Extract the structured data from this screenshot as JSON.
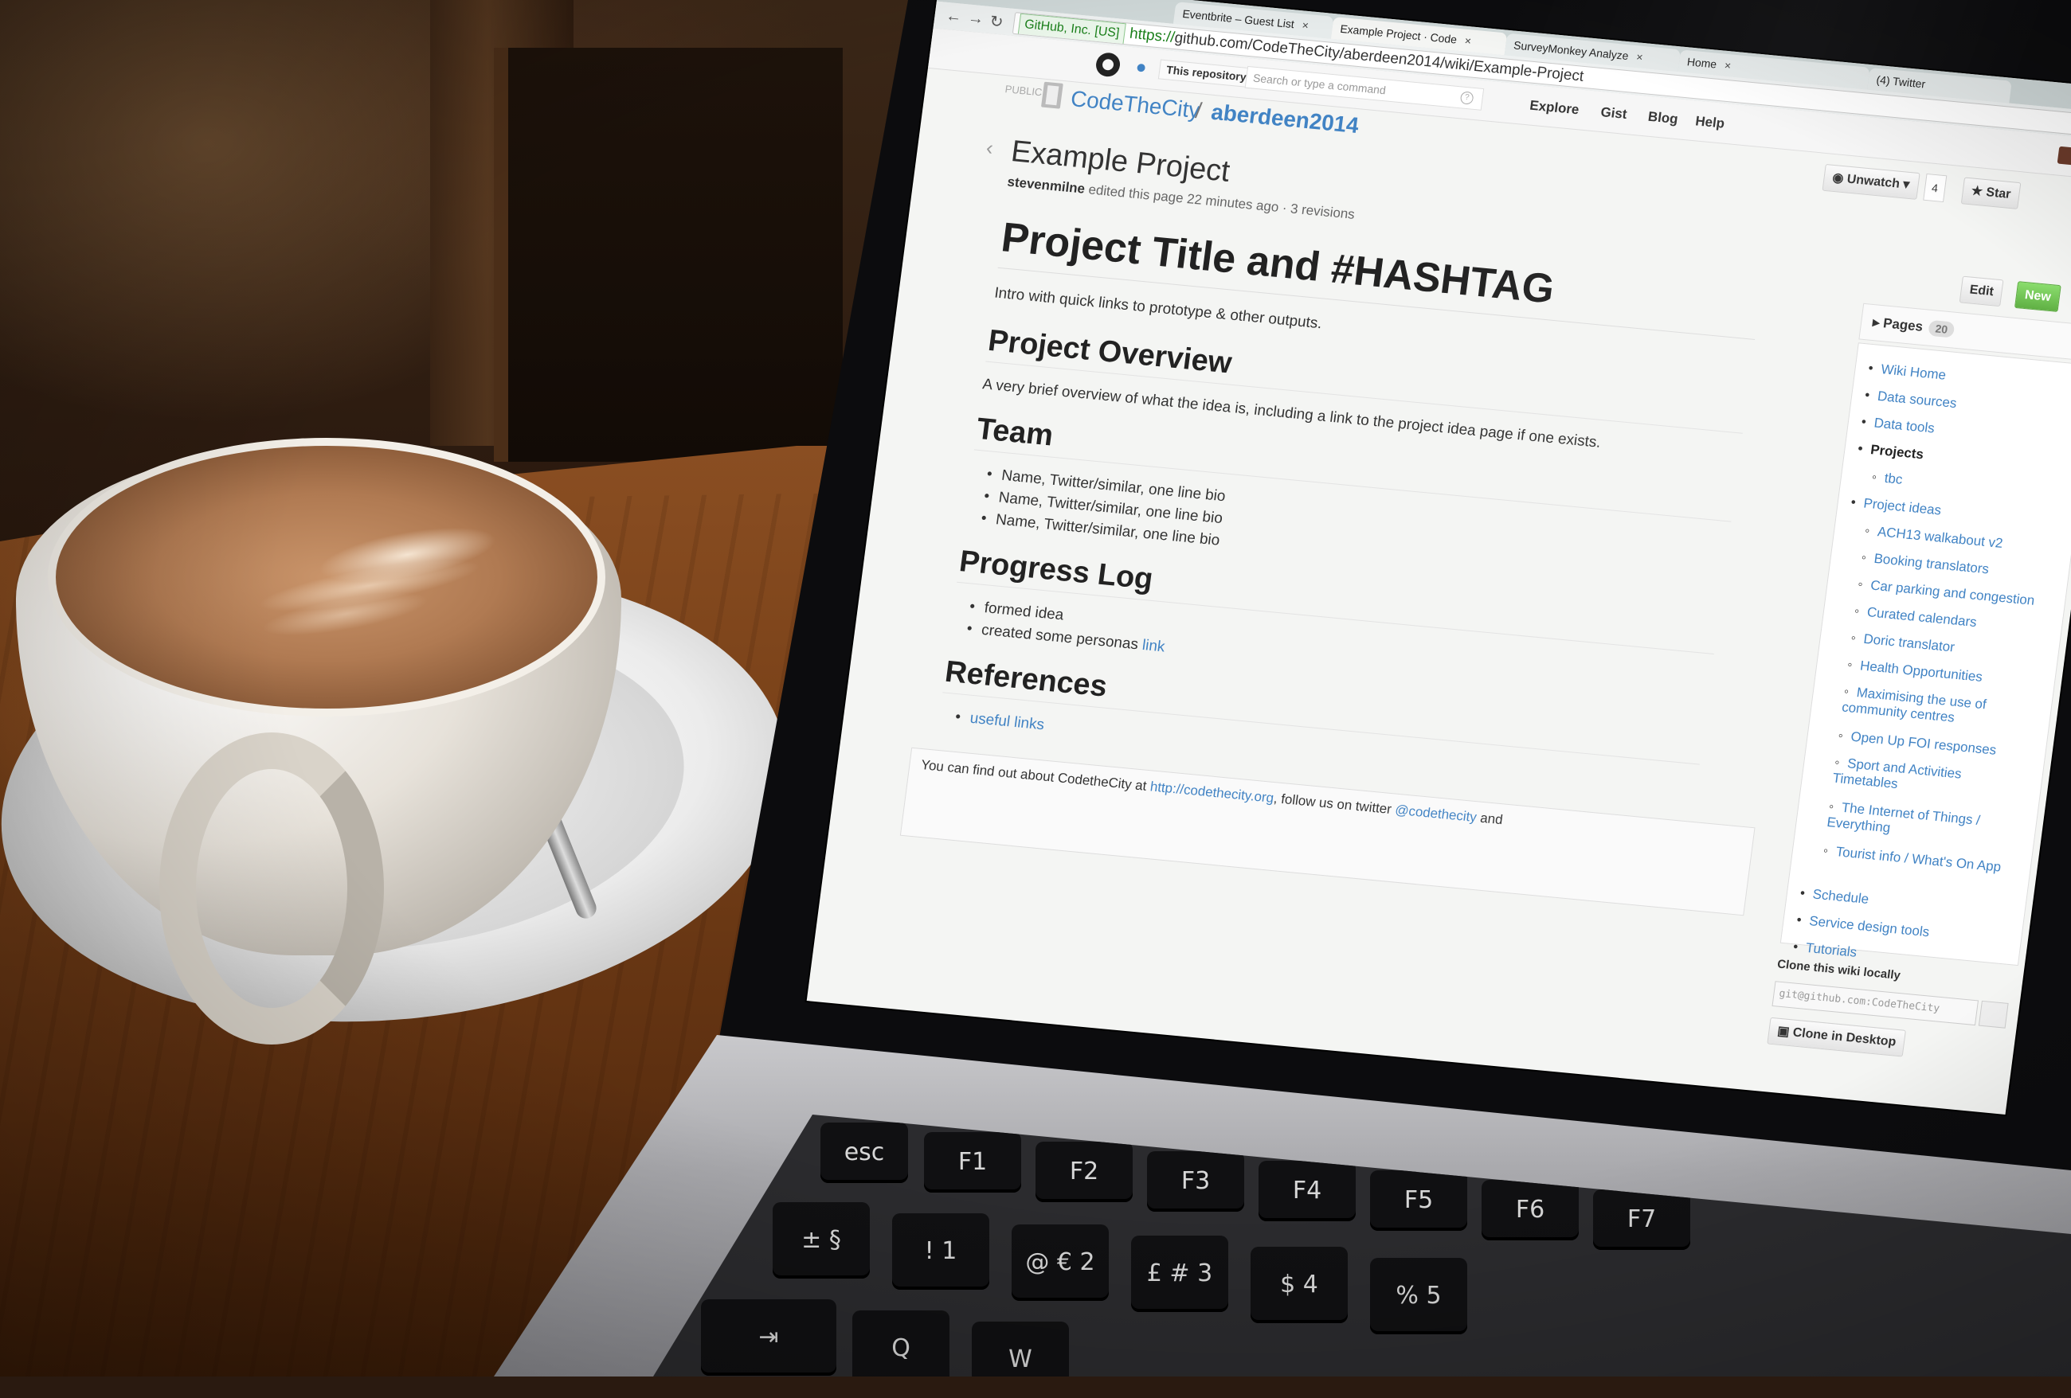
{
  "browser": {
    "tabs": [
      {
        "label": "Eventbrite – Guest List",
        "active": false
      },
      {
        "label": "Example Project · Code",
        "active": true
      },
      {
        "label": "SurveyMonkey Analyze",
        "active": false
      },
      {
        "label": "Home",
        "active": false
      },
      {
        "label": "(4) Twitter",
        "active": false
      }
    ],
    "ev_badge": "GitHub, Inc. [US]",
    "url_scheme": "https://",
    "url_rest": "github.com/CodeTheCity/aberdeen2014/wiki/Example-Project",
    "ext_count": "12"
  },
  "github_header": {
    "scope": "This repository ▾",
    "search_placeholder": "Search or type a command",
    "help": "?",
    "nav": [
      "Explore",
      "Gist",
      "Blog",
      "Help"
    ],
    "user": "stevenmilne"
  },
  "repo": {
    "visibility": "PUBLIC",
    "owner": "CodeTheCity",
    "separator": "/",
    "name": "aberdeen2014",
    "unwatch_label": "Unwatch ▾",
    "watch_count": "4",
    "star_label": "★ Star"
  },
  "wiki_page": {
    "title": "Example Project",
    "author": "stevenmilne",
    "meta": "edited this page 22 minutes ago · 3 revisions",
    "edit_label": "Edit",
    "new_label": "New"
  },
  "content": {
    "h1": "Project Title and #HASHTAG",
    "intro": "Intro with quick links to prototype & other outputs.",
    "overview_heading": "Project Overview",
    "overview_text": "A very brief overview of what the idea is, including a link to the project idea page if one exists.",
    "team_heading": "Team",
    "team": [
      "Name, Twitter/similar, one line bio",
      "Name, Twitter/similar, one line bio",
      "Name, Twitter/similar, one line bio"
    ],
    "progress_heading": "Progress Log",
    "progress": [
      "formed idea",
      "created some personas"
    ],
    "progress_link": "link",
    "references_heading": "References",
    "references_link": "useful links",
    "footer_prefix": "You can find out about CodetheCity at",
    "footer_url": "http://codethecity.org",
    "footer_mid": ", follow us on twitter",
    "footer_handle": "@codethecity",
    "footer_suffix": "and"
  },
  "sidebar": {
    "pages_label": "Pages",
    "pages_count": "20",
    "items": [
      {
        "label": "Wiki Home",
        "level": 0
      },
      {
        "label": "Data sources",
        "level": 0
      },
      {
        "label": "Data tools",
        "level": 0
      },
      {
        "label": "Projects",
        "level": 0,
        "bold": true
      },
      {
        "label": "tbc",
        "level": 1
      },
      {
        "label": "Project ideas",
        "level": 0
      },
      {
        "label": "ACH13 walkabout v2",
        "level": 1
      },
      {
        "label": "Booking translators",
        "level": 1
      },
      {
        "label": "Car parking and congestion",
        "level": 1
      },
      {
        "label": "Curated calendars",
        "level": 1
      },
      {
        "label": "Doric translator",
        "level": 1
      },
      {
        "label": "Health Opportunities",
        "level": 1
      },
      {
        "label": "Maximising the use of community centres",
        "level": 1
      },
      {
        "label": "Open Up FOI responses",
        "level": 1
      },
      {
        "label": "Sport and Activities Timetables",
        "level": 1
      },
      {
        "label": "The Internet of Things / Everything",
        "level": 1
      },
      {
        "label": "Tourist info / What's On App",
        "level": 1
      },
      {
        "label": "Schedule",
        "level": 0
      },
      {
        "label": "Service design tools",
        "level": 0
      },
      {
        "label": "Tutorials",
        "level": 0
      }
    ],
    "clone_label": "Clone this wiki locally",
    "clone_url": "git@github.com:CodeTheCity",
    "clone_desktop": "Clone in Desktop"
  },
  "keyboard": {
    "row1": [
      "esc",
      "F1",
      "F2",
      "F3",
      "F4",
      "F5",
      "F6",
      "F7"
    ],
    "row2": [
      "± §",
      "! 1",
      "@ € 2",
      "£ # 3",
      "$ 4",
      "% 5"
    ],
    "row3": [
      "⇥",
      "Q",
      "W"
    ]
  },
  "colors": {
    "link": "#4183c4",
    "new_button": "#60b044",
    "table_wood": "#7a4219"
  }
}
